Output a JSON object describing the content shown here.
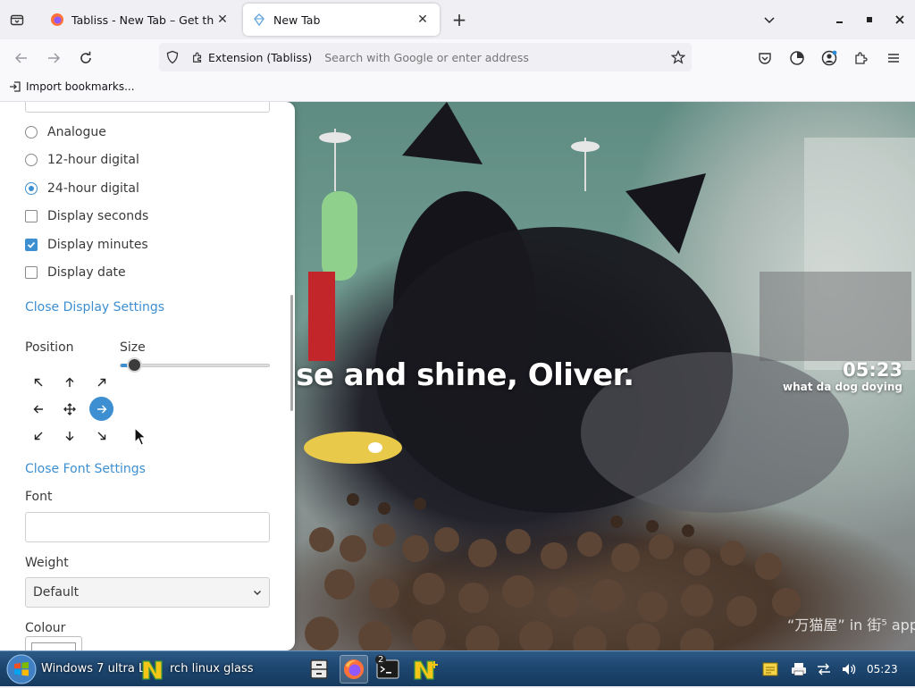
{
  "browser": {
    "tabs": [
      {
        "title": "Tabliss - New Tab – Get this Ex",
        "active": false
      },
      {
        "title": "New Tab",
        "active": true
      }
    ],
    "url_bar": {
      "identity_label": "Extension (Tabliss)",
      "placeholder": "Search with Google or enter address"
    },
    "bookmarks": [
      {
        "label": "Import bookmarks..."
      }
    ]
  },
  "settings": {
    "clock_options": [
      {
        "label": "Analogue",
        "selected": false
      },
      {
        "label": "12-hour digital",
        "selected": false
      },
      {
        "label": "24-hour digital",
        "selected": true
      }
    ],
    "checkboxes": [
      {
        "label": "Display seconds",
        "checked": false
      },
      {
        "label": "Display minutes",
        "checked": true
      },
      {
        "label": "Display date",
        "checked": false
      }
    ],
    "close_display_link": "Close Display Settings",
    "position_label": "Position",
    "size_label": "Size",
    "size_value_fraction": 0.09,
    "position_selected": "right",
    "close_font_link": "Close Font Settings",
    "font_label": "Font",
    "font_value": "",
    "weight_label": "Weight",
    "weight_value": "Default",
    "colour_label": "Colour"
  },
  "page": {
    "greeting": "ise and shine, Oliver.",
    "clock": "05:23",
    "clock_sub": "what da dog doying",
    "credit": "“万猫屋” in 街⁵ app"
  },
  "taskbar": {
    "task_text": "Windows 7 ultra L",
    "task_text_2": "rch linux glass",
    "terminal_badge": "2",
    "time": "05:23"
  },
  "colors": {
    "accent": "#3d8fd1",
    "taskbar": "#1d4670"
  }
}
